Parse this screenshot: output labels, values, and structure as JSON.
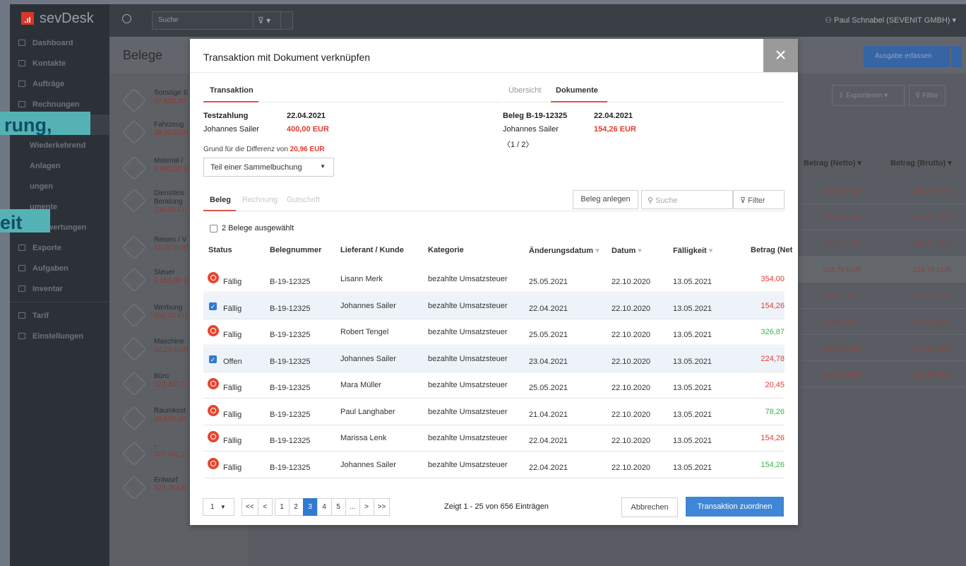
{
  "app": {
    "logo_text": "sevDesk"
  },
  "sidebar": {
    "items": [
      {
        "label": "Dashboard"
      },
      {
        "label": "Kontakte"
      },
      {
        "label": "Aufträge"
      },
      {
        "label": "Rechnungen"
      },
      {
        "label": "Belege"
      },
      {
        "label": "Wiederkehrend"
      },
      {
        "label": "Anlagen"
      },
      {
        "label": "ungen"
      },
      {
        "label": "umente"
      },
      {
        "label": "Auswertungen"
      },
      {
        "label": "Exporte"
      },
      {
        "label": "Aufgaben"
      },
      {
        "label": "Inventar"
      },
      {
        "label": "Tarif"
      },
      {
        "label": "Einstellungen"
      }
    ]
  },
  "topbar": {
    "search_placeholder": "Suche",
    "user": "Paul Schnabel (SEVENIT GMBH)"
  },
  "page": {
    "title": "Belege",
    "ausgabe_button": "Ausgabe erfassen",
    "export_button": "Exportieren",
    "filter_button": "Filter"
  },
  "overlay_chips": {
    "chip1": "rung,",
    "chip2": "eit"
  },
  "belege_list": [
    {
      "name": "Sonstige E",
      "value": "57.689,00"
    },
    {
      "name": "Fahrzeug",
      "value": "38,92 EUR"
    },
    {
      "name": "Material /",
      "value": "1.002,02 E"
    },
    {
      "name": "Dienstleis",
      "name2": "Beratung",
      "value": "136,00 EU"
    },
    {
      "name": "Reisen / V",
      "value": "10,00 EUR"
    },
    {
      "name": "Steuer",
      "value": "3.156,00 E"
    },
    {
      "name": "Werbung",
      "value": "600,00 EU"
    },
    {
      "name": "Maschine",
      "value": "52,23 EUR"
    },
    {
      "name": "Büro",
      "value": "123.337,3"
    },
    {
      "name": "Raumkost",
      "value": "10.500,00"
    },
    {
      "name": "-",
      "value": "327.161,2"
    },
    {
      "name": "Entwurf",
      "value": "523.754,8"
    }
  ],
  "right_table": {
    "headers": [
      "Betrag (Netto)",
      "Betrag (Brutto)"
    ],
    "rows": [
      [
        "354,00 EUR",
        "354,00 EUR"
      ],
      [
        "154,26 EUR",
        "154,26 EUR"
      ],
      [
        "326,87 EUR",
        "326,87 EUR"
      ],
      [
        "224,78 EUR",
        "224,78 EUR"
      ],
      [
        "20,45 EUR",
        "20,45 EUR"
      ],
      [
        "78,26 EUR",
        "78,26 EUR"
      ],
      [
        "154,26 EUR",
        "154,26 EUR"
      ],
      [
        "154,26 EUR",
        "154,26 EUR"
      ]
    ]
  },
  "modal": {
    "title": "Transaktion mit Dokument verknüpfen",
    "left_tab": "Transaktion",
    "right_tabs": [
      "Übersicht",
      "Dokumente"
    ],
    "transaction": {
      "name": "Testzahlung",
      "date": "22.04.2021",
      "person": "Johannes Sailer",
      "amount": "400,00 EUR"
    },
    "beleg": {
      "name": "Beleg B-19-12325",
      "date": "22.04.2021",
      "person": "Johannes Sailer",
      "amount": "154,26 EUR",
      "pager": "1 / 2"
    },
    "difference_label": "Grund für die Differenz von",
    "difference_value": "20,96 EUR",
    "select_value": "Teil einer Sammelbuchung",
    "doc_tabs": [
      "Beleg",
      "Rechnung",
      "Gutschrift"
    ],
    "beleg_anlegen": "Beleg anlegen",
    "search_placeholder": "Suche",
    "filter_label": "Filter",
    "selected_count": "2 Belege ausgewählt",
    "columns": [
      "Status",
      "Belegnummer",
      "Lieferant / Kunde",
      "Kategorie",
      "Änderungsdatum",
      "Datum",
      "Fälligkeit",
      "Betrag (Net"
    ],
    "rows": [
      {
        "status": "Fällig",
        "nr": "B-19-12325",
        "kunde": "Lisann Merk",
        "kat": "bezahlte Umsatzsteuer",
        "aend": "25.05.2021",
        "datum": "22.10.2020",
        "faell": "13.05.2021",
        "betrag": "354,00"
      },
      {
        "status": "Fällig",
        "nr": "B-19-12325",
        "kunde": "Johannes Sailer",
        "kat": "bezahlte Umsatzsteuer",
        "aend": "22.04.2021",
        "datum": "22.10.2020",
        "faell": "13.05.2021",
        "betrag": "154,26"
      },
      {
        "status": "Fällig",
        "nr": "B-19-12325",
        "kunde": "Robert Tengel",
        "kat": "bezahlte Umsatzsteuer",
        "aend": "25.05.2021",
        "datum": "22.10.2020",
        "faell": "13.05.2021",
        "betrag": "326,87"
      },
      {
        "status": "Offen",
        "nr": "B-19-12325",
        "kunde": "Johannes Sailer",
        "kat": "bezahlte Umsatzsteuer",
        "aend": "23.04.2021",
        "datum": "22.10.2020",
        "faell": "13.05.2021",
        "betrag": "224,78"
      },
      {
        "status": "Fällig",
        "nr": "B-19-12325",
        "kunde": "Mara Müller",
        "kat": "bezahlte Umsatzsteuer",
        "aend": "25.05.2021",
        "datum": "22.10.2020",
        "faell": "13.05.2021",
        "betrag": "20,45"
      },
      {
        "status": "Fällig",
        "nr": "B-19-12325",
        "kunde": "Paul Langhaber",
        "kat": "bezahlte Umsatzsteuer",
        "aend": "21.04.2021",
        "datum": "22.10.2020",
        "faell": "13.05.2021",
        "betrag": "78,26"
      },
      {
        "status": "Fällig",
        "nr": "B-19-12325",
        "kunde": "Marissa Lenk",
        "kat": "bezahlte Umsatzsteuer",
        "aend": "22.04.2021",
        "datum": "22.10.2020",
        "faell": "13.05.2021",
        "betrag": "154,26"
      },
      {
        "status": "Fällig",
        "nr": "B-19-12325",
        "kunde": "Johannes Sailer",
        "kat": "bezahlte Umsatzsteuer",
        "aend": "22.04.2021",
        "datum": "22.10.2020",
        "faell": "13.05.2021",
        "betrag": "154,26"
      }
    ],
    "pager": {
      "per_page": "1",
      "pages": [
        "<<",
        "<",
        "1",
        "2",
        "3",
        "4",
        "5",
        "...",
        ">",
        ">>"
      ],
      "info": "Zeigt 1 - 25 von 656 Einträgen"
    },
    "cancel": "Abbrechen",
    "confirm": "Transaktion zuordnen"
  },
  "colors": {
    "accent": "#2f7bd1",
    "danger": "#e23b2e",
    "success": "#3cb54a",
    "teal": "#55b2b4"
  }
}
